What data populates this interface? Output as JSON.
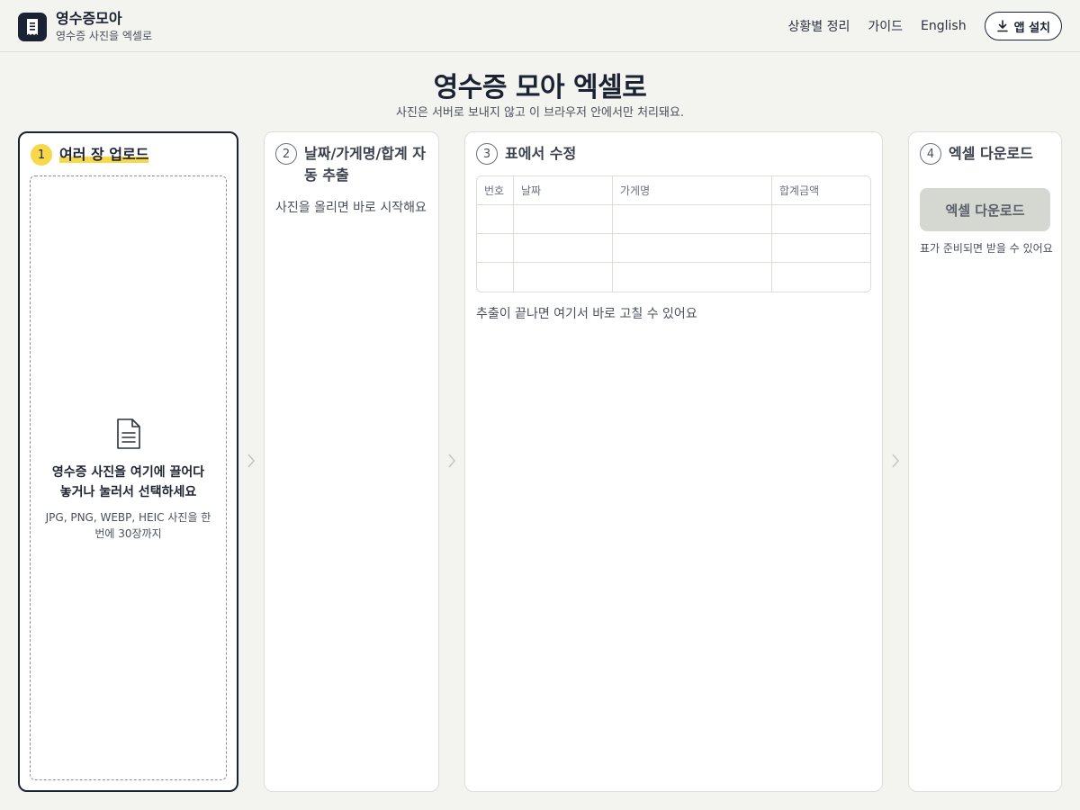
{
  "brand": {
    "name": "영수증모아",
    "subtitle": "영수증 사진을 엑셀로"
  },
  "nav": {
    "items": [
      "상황별 정리",
      "가이드",
      "English"
    ],
    "install_label": "앱 설치"
  },
  "hero": {
    "title": "영수증 모아 엑셀로",
    "subtitle": "사진은 서버로 보내지 않고 이 브라우저 안에서만 처리돼요."
  },
  "steps": [
    {
      "num": "1",
      "title": "여러 장 업로드",
      "drop_main": "영수증 사진을 여기에 끌어다 놓거나 눌러서 선택하세요",
      "drop_hint": "JPG, PNG, WEBP, HEIC 사진을 한 번에 30장까지"
    },
    {
      "num": "2",
      "title": "날짜/가게명/합계 자동 추출",
      "desc": "사진을 올리면 바로 시작해요"
    },
    {
      "num": "3",
      "title": "표에서 수정",
      "columns": [
        "번호",
        "날짜",
        "가게명",
        "합계금액"
      ],
      "desc": "추출이 끝나면 여기서 바로 고칠 수 있어요"
    },
    {
      "num": "4",
      "title": "엑셀 다운로드",
      "button": "엑셀 다운로드",
      "note": "표가 준비되면 받을 수 있어요"
    }
  ],
  "colors": {
    "accent": "#f7d84a",
    "dark": "#1b2233",
    "background": "#f3f4f0"
  }
}
